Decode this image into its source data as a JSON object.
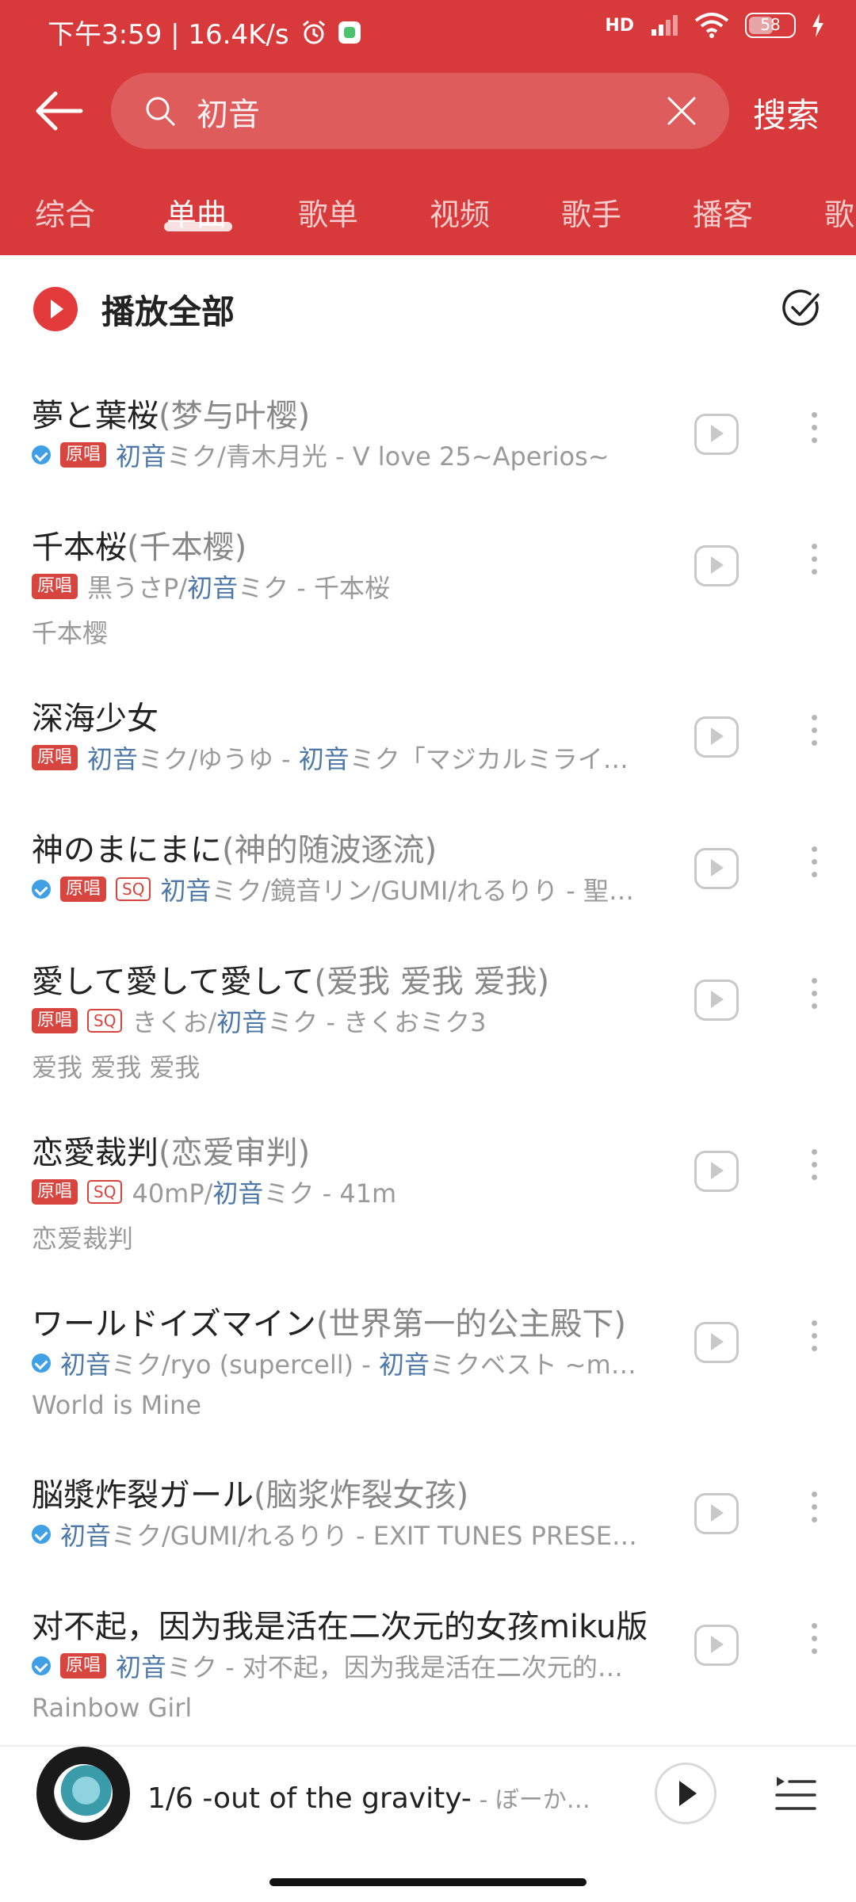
{
  "status_bar": {
    "time_speed": "下午3:59 | 16.4K/s",
    "network": "HD",
    "battery": "58"
  },
  "search": {
    "query": "初音",
    "submit_label": "搜索"
  },
  "tabs": [
    "综合",
    "单曲",
    "歌单",
    "视频",
    "歌手",
    "播客",
    "歌"
  ],
  "active_tab": "单曲",
  "play_all": {
    "label": "播放全部"
  },
  "songs": [
    {
      "title": "夢と葉桜",
      "alias": "(梦与叶樱)",
      "verified": true,
      "original": true,
      "sq": false,
      "artist_hl": "初音",
      "artist_rest": "ミク/青木月光 - V love 25~Aperios~",
      "lyric": ""
    },
    {
      "title": "千本桜",
      "alias": "(千本樱)",
      "verified": false,
      "original": true,
      "sq": false,
      "artist_pre": "黒うさP/",
      "artist_hl": "初音",
      "artist_rest": "ミク - 千本桜",
      "lyric": "千本樱"
    },
    {
      "title": "深海少女",
      "alias": "",
      "verified": false,
      "original": true,
      "sq": false,
      "artist_hl": "初音",
      "artist_rest": "ミク/ゆうゆ - ",
      "artist_hl2": "初音",
      "artist_rest2": "ミク「マジカルミライ…",
      "lyric": ""
    },
    {
      "title": "神のまにまに",
      "alias": "(神的随波逐流)",
      "verified": true,
      "original": true,
      "sq": true,
      "artist_hl": "初音",
      "artist_rest": "ミク/鏡音リン/GUMI/れるりり - 聖…",
      "lyric": ""
    },
    {
      "title": "愛して愛して愛して",
      "alias": "(爱我 爱我 爱我)",
      "verified": false,
      "original": true,
      "sq": true,
      "artist_pre": "きくお/",
      "artist_hl": "初音",
      "artist_rest": "ミク - きくおミク3",
      "lyric": "爱我 爱我 爱我"
    },
    {
      "title": "恋愛裁判",
      "alias": "(恋爱审判)",
      "verified": false,
      "original": true,
      "sq": true,
      "artist_pre": "40mP/",
      "artist_hl": "初音",
      "artist_rest": "ミク - 41m",
      "lyric": "恋爱裁判"
    },
    {
      "title": "ワールドイズマイン",
      "alias": "(世界第一的公主殿下)",
      "verified": true,
      "original": false,
      "sq": false,
      "artist_hl": "初音",
      "artist_rest": "ミク/ryo (supercell) - ",
      "artist_hl2": "初音",
      "artist_rest2": "ミクベスト ~m…",
      "lyric": "World is Mine"
    },
    {
      "title": "脳漿炸裂ガール",
      "alias": "(脑浆炸裂女孩)",
      "verified": true,
      "original": false,
      "sq": false,
      "artist_hl": "初音",
      "artist_rest": "ミク/GUMI/れるりり - EXIT TUNES PRESE…",
      "lyric": ""
    },
    {
      "title": "对不起，因为我是活在二次元的女孩miku版",
      "alias": "",
      "verified": true,
      "original": true,
      "sq": false,
      "artist_hl": "初音",
      "artist_rest": "ミク - 对不起，因为我是活在二次元的…",
      "lyric": "Rainbow Girl"
    }
  ],
  "badges": {
    "original": "原唱",
    "sq": "SQ"
  },
  "now_playing": {
    "title": "1/6 -out of the gravity-",
    "artist": " - ぼーか…"
  },
  "colors": {
    "header": "#d8393a",
    "accent": "#e33b3b",
    "artist_highlight": "#4d78a8"
  }
}
